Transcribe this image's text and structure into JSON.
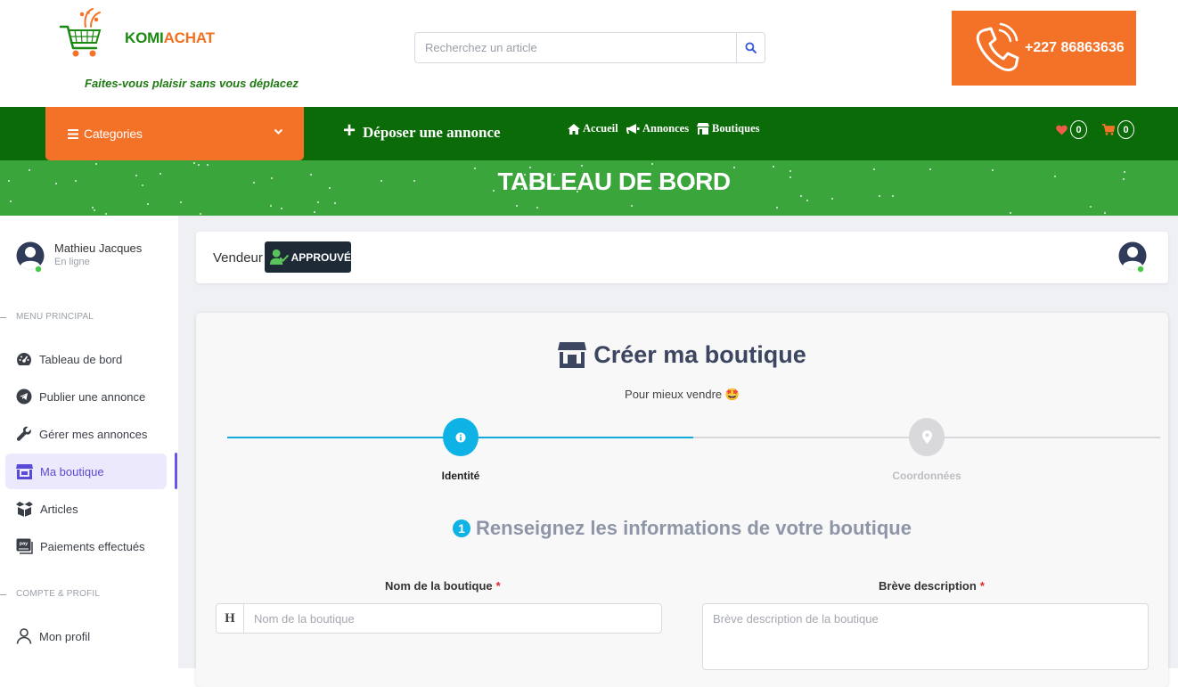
{
  "brand": {
    "name_part1": "KOMI",
    "name_part2": "ACHAT",
    "tagline": "Faites-vous plaisir sans vous déplacez"
  },
  "search": {
    "placeholder": "Recherchez un article"
  },
  "contact": {
    "phone": "+227 86863636"
  },
  "nav": {
    "categories_label": "Categories",
    "post_ad_label": "Déposer une annonce",
    "links": [
      "Accueil",
      "Annonces",
      "Boutiques"
    ],
    "wishlist_count": "0",
    "cart_count": "0"
  },
  "banner": {
    "title": "TABLEAU DE BORD"
  },
  "user": {
    "name": "Mathieu Jacques",
    "status": "En ligne"
  },
  "sidebar": {
    "section_main": "MENU PRINCIPAL",
    "items": [
      "Tableau de bord",
      "Publier une annonce",
      "Gérer mes annonces",
      "Ma boutique",
      "Articles",
      "Paiements effectués"
    ],
    "section_account": "COMPTE & PROFIL",
    "account_items": [
      "Mon profil"
    ]
  },
  "vendor": {
    "label": "Vendeur",
    "status_badge": "APPROUVÉ"
  },
  "form": {
    "title": "Créer ma boutique",
    "subtitle": "Pour mieux vendre 🤩",
    "steps": [
      "Identité",
      "Coordonnées"
    ],
    "step_number": "1",
    "section_heading": "Renseignez les informations de votre boutique",
    "name_label": "Nom de la boutique",
    "name_prefix": "H",
    "name_placeholder": "Nom de la boutique",
    "desc_label": "Brève description",
    "desc_placeholder": "Brève description de la boutique",
    "required_mark": "*"
  },
  "colors": {
    "orange": "#f47128",
    "dark_green": "#0b6b08",
    "light_green": "#3aa53a",
    "accent": "#6754e8",
    "step_blue": "#0fb2e4"
  }
}
